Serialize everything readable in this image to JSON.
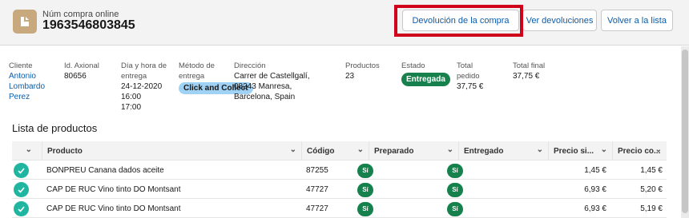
{
  "header": {
    "subtitle": "Núm compra online",
    "number": "1963546803845",
    "buttons": {
      "devolucion": "Devolución de la compra",
      "ver_devoluciones": "Ver devoluciones",
      "volver": "Volver a la lista"
    }
  },
  "details": {
    "cliente": {
      "label": "Cliente",
      "value_lines": [
        "Antonio",
        "Lombardo",
        "Perez"
      ]
    },
    "id_axional": {
      "label": "Id. Axional",
      "value": "80656"
    },
    "dia_hora": {
      "label_lines": [
        "Día y hora de",
        "entrega"
      ],
      "value_lines": [
        "24-12-2020",
        "16:00",
        "17:00"
      ]
    },
    "metodo": {
      "label_lines": [
        "Método de",
        "entrega"
      ],
      "value": "Click and Collect"
    },
    "direccion": {
      "label": "Dirección",
      "value_lines": [
        "Carrer de Castellgalí,",
        "08243 Manresa,",
        "Barcelona, Spain"
      ]
    },
    "productos": {
      "label": "Productos",
      "value": "23"
    },
    "estado": {
      "label": "Estado",
      "value": "Entregada"
    },
    "total_pedido": {
      "label_lines": [
        "Total",
        "pedido"
      ],
      "value": "37,75 €"
    },
    "total_final": {
      "label": "Total final",
      "value": "37,75 €"
    }
  },
  "products": {
    "title": "Lista de productos",
    "columns": {
      "producto": "Producto",
      "codigo": "Código",
      "preparado": "Preparado",
      "entregado": "Entregado",
      "precio_si": "Precio si...",
      "precio_co": "Precio co..."
    },
    "rows": [
      {
        "producto": "BONPREU Canana dados aceite",
        "codigo": "87255",
        "preparado": "Sí",
        "entregado": "Sí",
        "precio_si": "1,45 €",
        "precio_co": "1,45 €"
      },
      {
        "producto": "CAP DE RUC Vino tinto DO Montsant",
        "codigo": "47727",
        "preparado": "Sí",
        "entregado": "Sí",
        "precio_si": "6,93 €",
        "precio_co": "5,20 €"
      },
      {
        "producto": "CAP DE RUC Vino tinto DO Montsant",
        "codigo": "47727",
        "preparado": "Sí",
        "entregado": "Sí",
        "precio_si": "6,93 €",
        "precio_co": "5,19 €"
      }
    ]
  },
  "colors": {
    "accent_link": "#0b5cab",
    "status_green": "#16814d",
    "highlight_red": "#d0021b",
    "check_teal": "#1fb5a1"
  },
  "icons": [
    "order-icon",
    "chevron-down-icon",
    "check-icon"
  ]
}
